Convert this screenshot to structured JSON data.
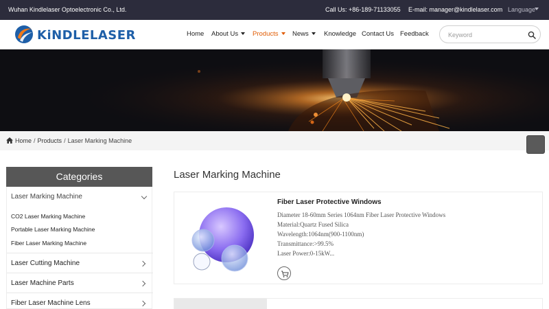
{
  "topbar": {
    "company": "Wuhan Kindlelaser Optoelectronic Co., Ltd.",
    "call": "Call Us: +86-189-71133055",
    "email": "E-mail: manager@kindlelaser.com",
    "language": "Language"
  },
  "header": {
    "logo_text": "KiNDLELASER",
    "nav": [
      {
        "label": "Home"
      },
      {
        "label": "About Us"
      },
      {
        "label": "Products"
      },
      {
        "label": "News"
      },
      {
        "label": "Knowledge"
      },
      {
        "label": "Contact Us"
      },
      {
        "label": "Feedback"
      }
    ],
    "search_placeholder": "Keyword"
  },
  "breadcrumb": {
    "home": "Home",
    "products": "Products",
    "current": "Laser Marking Machine",
    "separator": "/"
  },
  "sidebar": {
    "title": "Categories",
    "expanded": {
      "label": "Laser Marking Machine",
      "items": [
        "CO2 Laser Marking Machine",
        "Portable Laser Marking Machine",
        "Fiber Laser Marking Machine"
      ]
    },
    "categories": [
      "Laser Cutting Machine",
      "Laser Machine Parts",
      "Fiber Laser Machine Lens"
    ]
  },
  "main": {
    "title": "Laser Marking Machine",
    "products": [
      {
        "title": "Fiber Laser Protective Windows",
        "lines": [
          "Diameter 18-60mm Series 1064nm Fiber Laser Protective Windows",
          "Material:Quartz Fused Silica",
          "Wavelength:1064nm(900-1100nm)",
          "Transmittance:>99.5%",
          "Laser Power:0-15kW..."
        ]
      }
    ]
  },
  "colors": {
    "topbar_bg": "#2c2c3c",
    "accent": "#e05a00",
    "logo_blue": "#1e5fa8",
    "category_header": "#575757"
  },
  "icons": [
    "logo-mark-icon",
    "chevron-down-icon",
    "search-icon",
    "home-icon",
    "chevron-right-icon",
    "cart-icon"
  ]
}
